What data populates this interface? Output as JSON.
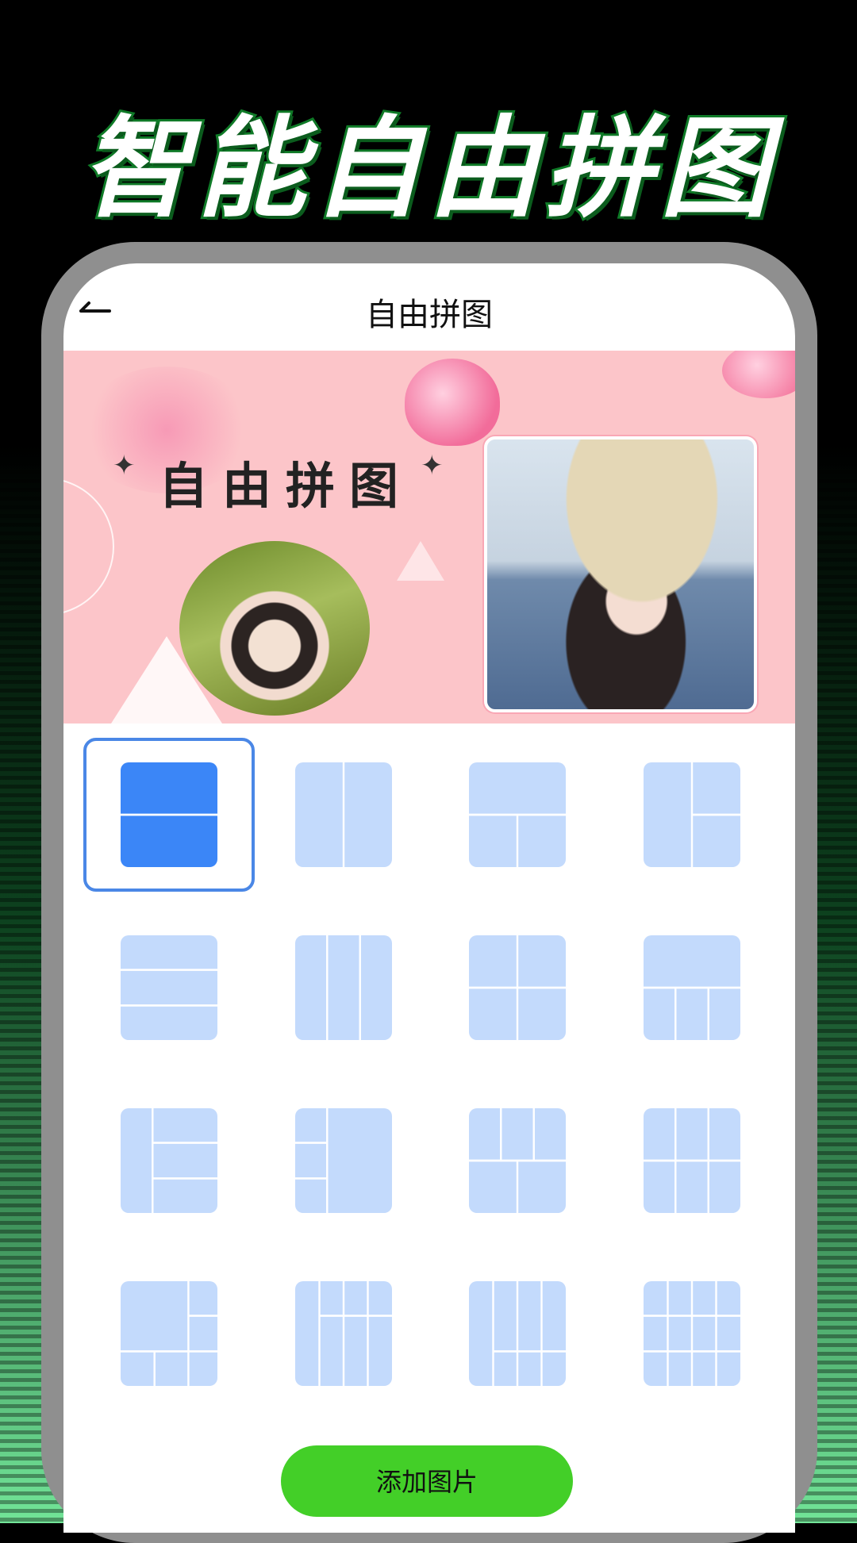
{
  "headline": "智能自由拼图",
  "nav": {
    "title": "自由拼图"
  },
  "banner": {
    "title": "自由拼图"
  },
  "layouts": {
    "selected_index": 0,
    "items": [
      {
        "name": "layout-2-rows"
      },
      {
        "name": "layout-2-cols"
      },
      {
        "name": "layout-top-1-bottom-2"
      },
      {
        "name": "layout-left-1-right-2"
      },
      {
        "name": "layout-3-rows"
      },
      {
        "name": "layout-3-cols"
      },
      {
        "name": "layout-2x2"
      },
      {
        "name": "layout-top-1-bottom-3"
      },
      {
        "name": "layout-left-1-right-3"
      },
      {
        "name": "layout-left-3-right-1"
      },
      {
        "name": "layout-top-2-bottom-2b"
      },
      {
        "name": "layout-top-3-bottom-3"
      },
      {
        "name": "layout-big-top-left-5"
      },
      {
        "name": "layout-4-cols-2-rows"
      },
      {
        "name": "layout-4-cols-3-rows"
      },
      {
        "name": "layout-4x4"
      }
    ]
  },
  "add_button": {
    "label": "添加图片"
  },
  "colors": {
    "accent": "#3b86f7",
    "tile_light": "#c3dafc",
    "button": "#43cf28",
    "banner": "#fcc5c9"
  }
}
